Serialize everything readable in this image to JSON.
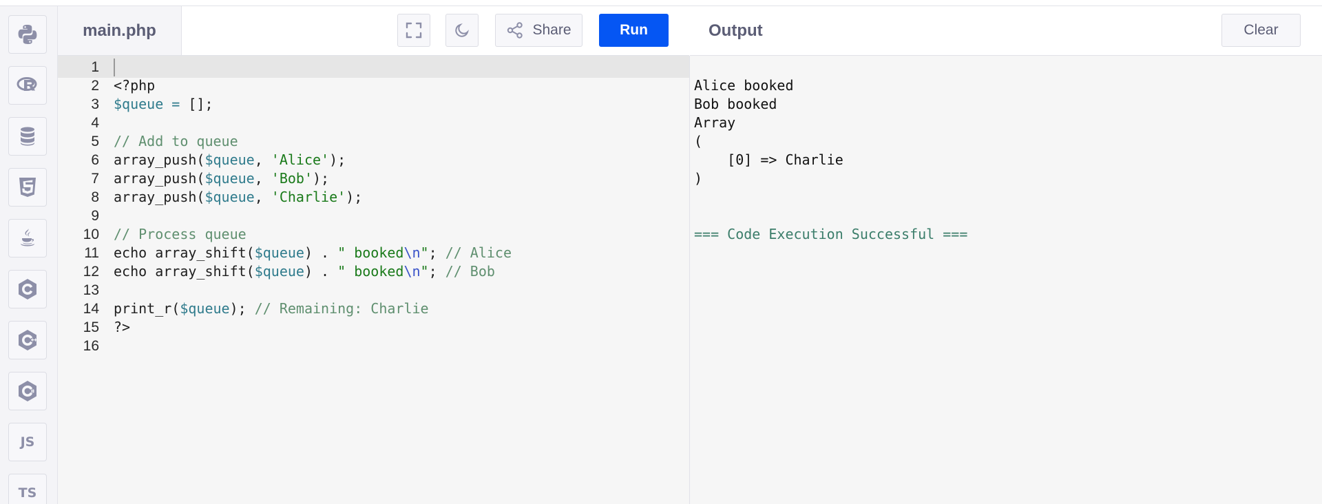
{
  "sidebar": {
    "languages": [
      {
        "name": "Python",
        "icon": "python-icon"
      },
      {
        "name": "R",
        "icon": "r-icon"
      },
      {
        "name": "SQL",
        "icon": "database-icon"
      },
      {
        "name": "HTML",
        "icon": "html5-icon"
      },
      {
        "name": "Java",
        "icon": "java-icon"
      },
      {
        "name": "C",
        "icon": "c-icon"
      },
      {
        "name": "C++",
        "icon": "cpp-icon"
      },
      {
        "name": "C#",
        "icon": "csharp-icon"
      },
      {
        "name": "JS",
        "label": "JS",
        "icon": "js-icon"
      },
      {
        "name": "TS",
        "label": "TS",
        "icon": "ts-icon"
      }
    ]
  },
  "editor": {
    "file_name": "main.php",
    "share_label": "Share",
    "run_label": "Run",
    "line_numbers": [
      "1",
      "2",
      "3",
      "4",
      "5",
      "6",
      "7",
      "8",
      "9",
      "10",
      "11",
      "12",
      "13",
      "14",
      "15",
      "16"
    ],
    "lines": [
      "",
      "<?php",
      "$queue = [];",
      "",
      "// Add to queue",
      "array_push($queue, 'Alice');",
      "array_push($queue, 'Bob');",
      "array_push($queue, 'Charlie');",
      "",
      "// Process queue",
      "echo array_shift($queue) . \" booked\\n\"; // Alice",
      "echo array_shift($queue) . \" booked\\n\"; // Bob",
      "",
      "print_r($queue); // Remaining: Charlie",
      "?>",
      ""
    ]
  },
  "output": {
    "title": "Output",
    "clear_label": "Clear",
    "lines": [
      "",
      "Alice booked",
      "Bob booked",
      "Array",
      "(",
      "    [0] => Charlie",
      ")",
      "",
      "",
      "=== Code Execution Successful ==="
    ]
  },
  "colors": {
    "run_button": "#0556f3",
    "variable": "#2f7b8c",
    "string": "#1a7a1a",
    "comment": "#5f8f6f"
  }
}
